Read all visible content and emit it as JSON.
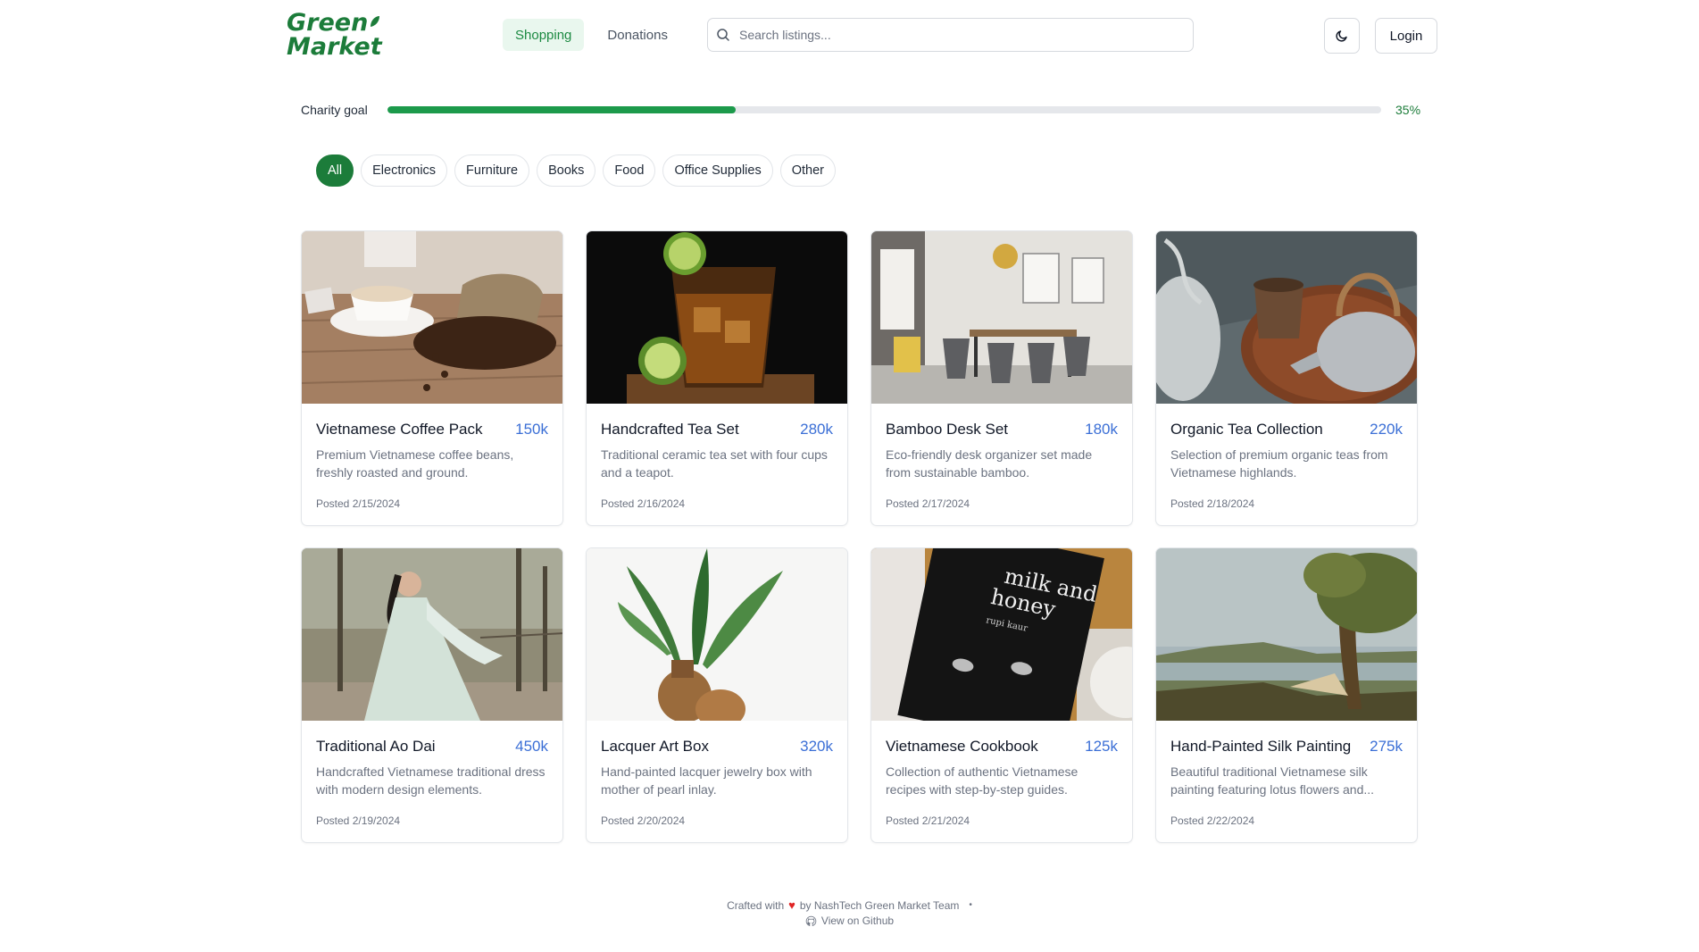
{
  "header": {
    "logo_line1": "Green",
    "logo_line2": "Market",
    "nav": [
      {
        "label": "Shopping",
        "active": true
      },
      {
        "label": "Donations",
        "active": false
      }
    ],
    "search_placeholder": "Search listings...",
    "theme_icon": "moon-icon",
    "login_label": "Login"
  },
  "charity": {
    "label": "Charity goal",
    "progress": 0.35,
    "percent_text": "35%",
    "color": "#1c9a4b"
  },
  "filters": [
    {
      "label": "All",
      "active": true
    },
    {
      "label": "Electronics",
      "active": false
    },
    {
      "label": "Furniture",
      "active": false
    },
    {
      "label": "Books",
      "active": false
    },
    {
      "label": "Food",
      "active": false
    },
    {
      "label": "Office Supplies",
      "active": false
    },
    {
      "label": "Other",
      "active": false
    }
  ],
  "listings": [
    {
      "title": "Vietnamese Coffee Pack",
      "price": "150k",
      "desc": "Premium Vietnamese coffee beans, freshly roasted and ground.",
      "posted": "Posted 2/15/2024"
    },
    {
      "title": "Handcrafted Tea Set",
      "price": "280k",
      "desc": "Traditional ceramic tea set with four cups and a teapot.",
      "posted": "Posted 2/16/2024"
    },
    {
      "title": "Bamboo Desk Set",
      "price": "180k",
      "desc": "Eco-friendly desk organizer set made from sustainable bamboo.",
      "posted": "Posted 2/17/2024"
    },
    {
      "title": "Organic Tea Collection",
      "price": "220k",
      "desc": "Selection of premium organic teas from Vietnamese highlands.",
      "posted": "Posted 2/18/2024"
    },
    {
      "title": "Traditional Ao Dai",
      "price": "450k",
      "desc": "Handcrafted Vietnamese traditional dress with modern design elements.",
      "posted": "Posted 2/19/2024"
    },
    {
      "title": "Lacquer Art Box",
      "price": "320k",
      "desc": "Hand-painted lacquer jewelry box with mother of pearl inlay.",
      "posted": "Posted 2/20/2024"
    },
    {
      "title": "Vietnamese Cookbook",
      "price": "125k",
      "desc": "Collection of authentic Vietnamese recipes with step-by-step guides.",
      "posted": "Posted 2/21/2024"
    },
    {
      "title": "Hand-Painted Silk Painting",
      "price": "275k",
      "desc": "Beautiful traditional Vietnamese silk painting featuring lotus flowers and...",
      "posted": "Posted 2/22/2024"
    }
  ],
  "book_cover": {
    "title_line1": "milk and",
    "title_line2": "honey",
    "author": "rupi kaur"
  },
  "footer": {
    "crafted_prefix": "Crafted with",
    "crafted_suffix": "by NashTech Green Market Team",
    "github_label": "View on Github"
  }
}
